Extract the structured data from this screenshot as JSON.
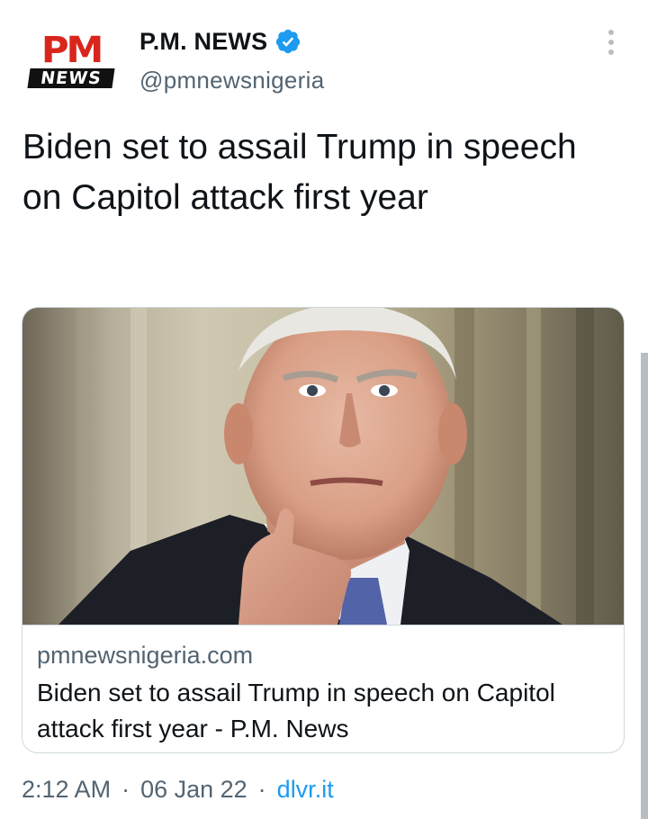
{
  "account": {
    "logo_top": "PM",
    "logo_bottom": "NEWS",
    "display_name": "P.M. NEWS",
    "handle": "@pmnewsnigeria",
    "verified": true,
    "verified_color": "#1d9bf0"
  },
  "tweet": {
    "text": "Biden set to assail Trump in speech on Capitol attack first year"
  },
  "card": {
    "domain": "pmnewsnigeria.com",
    "title": "Biden set to assail Trump in speech on Capitol attack first year - P.M. News"
  },
  "meta": {
    "time": "2:12 AM",
    "separator": "·",
    "date": "06 Jan 22",
    "source": "dlvr.it"
  },
  "colors": {
    "accent": "#1d9bf0",
    "logo_red": "#d9261c",
    "secondary_text": "#536471"
  },
  "icons": {
    "verified": "verified-badge-icon",
    "more": "more-vertical-icon"
  }
}
